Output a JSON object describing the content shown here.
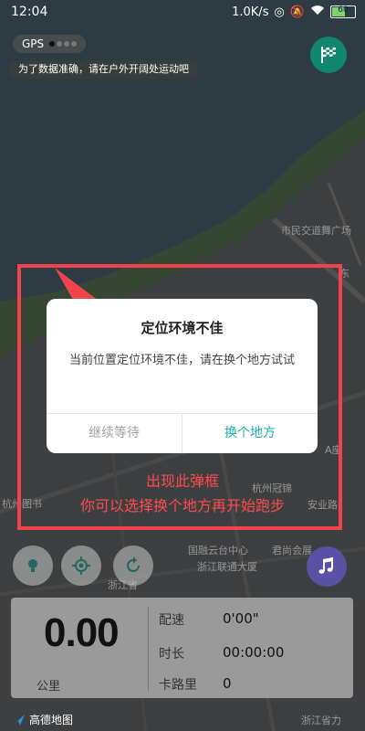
{
  "status_bar": {
    "time": "12:04",
    "network_speed": "1.0K/s",
    "battery": "60"
  },
  "gps": {
    "label": "GPS",
    "signal_bars_on": 1,
    "signal_bars_total": 4,
    "hint": "为了数据准确，请在户外开阔处运动吧"
  },
  "map": {
    "labels": [
      "市民交道舞广场",
      "杭州图书",
      "杭州冠锦",
      "安业路",
      "国融云台中心",
      "君尚会展",
      "浙江联通大厦",
      "浙江省",
      "A座",
      "东",
      "浙江省力"
    ],
    "logo": "高德地图"
  },
  "dialog": {
    "title": "定位环境不佳",
    "message": "当前位置定位环境不佳，请在换个地方试试",
    "wait_button": "继续等待",
    "change_button": "换个地方"
  },
  "annotation": {
    "line1": "出现此弹框",
    "line2": "你可以选择换个地方再开始跑步"
  },
  "run_panel": {
    "distance": "0.00",
    "distance_unit": "公里",
    "pace_label": "配速",
    "pace_value": "0'00\"",
    "duration_label": "时长",
    "duration_value": "00:00:00",
    "calorie_label": "卡路里",
    "calorie_value": "0"
  },
  "colors": {
    "accent": "#1ab2a8",
    "flag_button": "#11876f",
    "annotation": "#f0434b",
    "music_button": "#5b4fa6"
  }
}
